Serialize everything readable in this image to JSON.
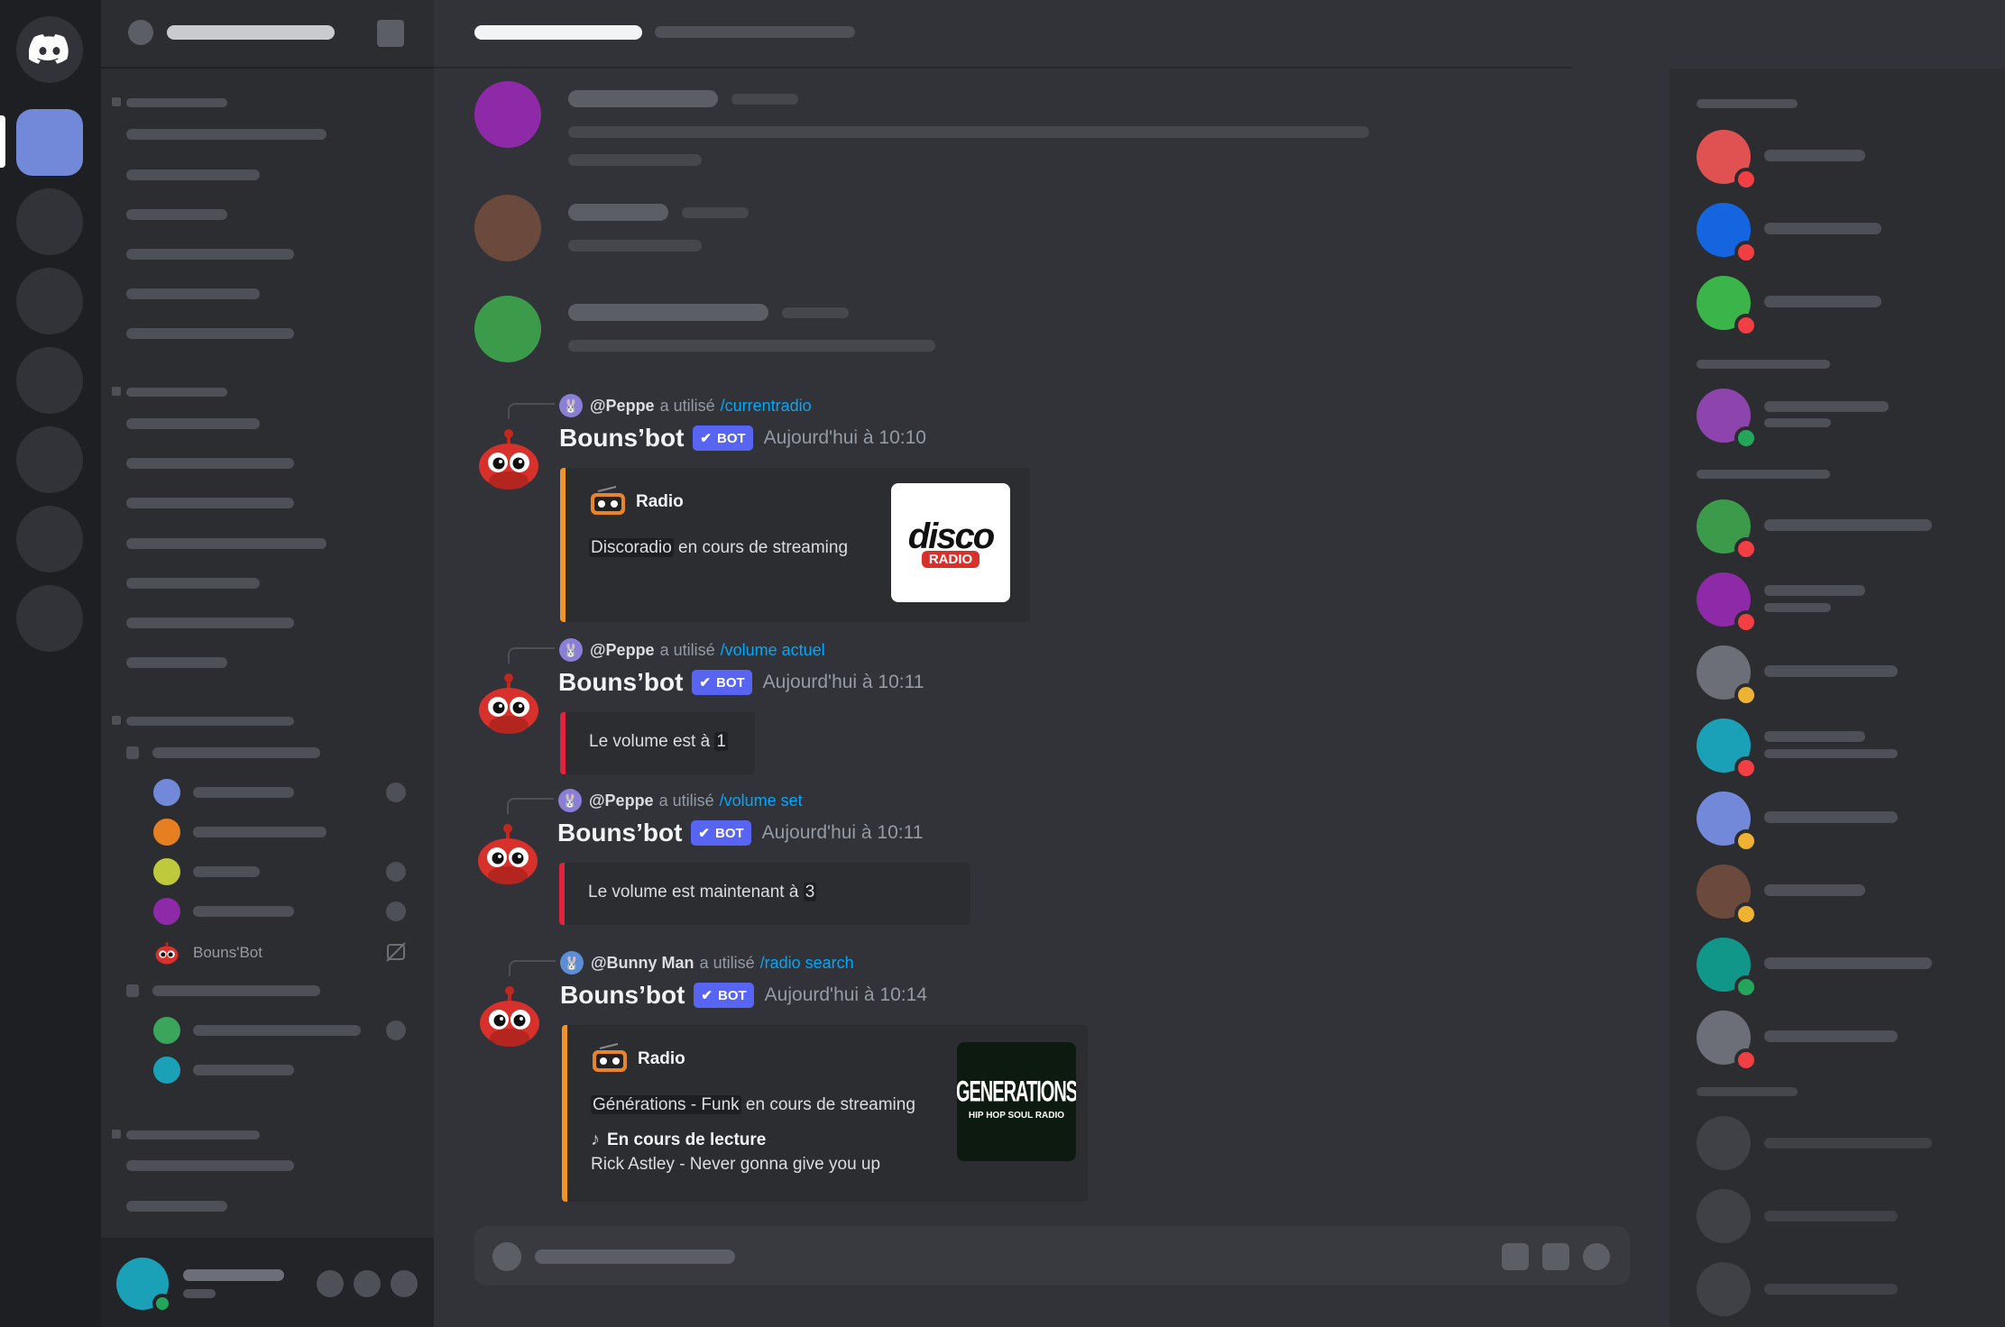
{
  "sidebar": {
    "bot_member_name": "Bouns'Bot"
  },
  "messages": [
    {
      "reply_user": "@Peppe",
      "reply_used": "a utilisé",
      "reply_command": "/currentradio",
      "author": "Bouns’bot",
      "badge": "BOT",
      "timestamp": "Aujourd'hui à 10:10",
      "embed": {
        "title": "Radio",
        "station": "Discoradio",
        "suffix": " en cours de streaming",
        "thumb_text": "disco",
        "thumb_sub": "RADIO"
      }
    },
    {
      "reply_user": "@Peppe",
      "reply_used": "a utilisé",
      "reply_command": "/volume actuel",
      "author": "Bouns’bot",
      "badge": "BOT",
      "timestamp": "Aujourd'hui à 10:11",
      "embed": {
        "prefix": "Le volume est à ",
        "value": "1"
      }
    },
    {
      "reply_user": "@Peppe",
      "reply_used": "a utilisé",
      "reply_command": "/volume set",
      "author": "Bouns’bot",
      "badge": "BOT",
      "timestamp": "Aujourd'hui à 10:11",
      "embed": {
        "prefix": "Le volume est maintenant à ",
        "value": "3"
      }
    },
    {
      "reply_user": "@Bunny Man",
      "reply_used": "a utilisé",
      "reply_command": "/radio search",
      "author": "Bouns’bot",
      "badge": "BOT",
      "timestamp": "Aujourd'hui à 10:14",
      "embed": {
        "title": "Radio",
        "station": "Générations - Funk",
        "suffix": " en cours de streaming",
        "now_playing_label": "En cours de lecture",
        "track": "Rick Astley - Never gonna give you up",
        "thumb_text": "GENERATIONS",
        "thumb_sub": "HIP HOP SOUL RADIO"
      }
    }
  ],
  "colors": {
    "background": "#313338",
    "sidebar": "#2b2d31",
    "rail": "#1e1f22",
    "blurple": "#5865f2",
    "embed_orange": "#f0932b",
    "embed_red": "#e0243e",
    "command_blue": "#00a8fc"
  },
  "icons": {
    "discord": "discord-logo-icon",
    "check": "check-icon",
    "radio": "radio-icon",
    "note": "music-note-icon"
  }
}
